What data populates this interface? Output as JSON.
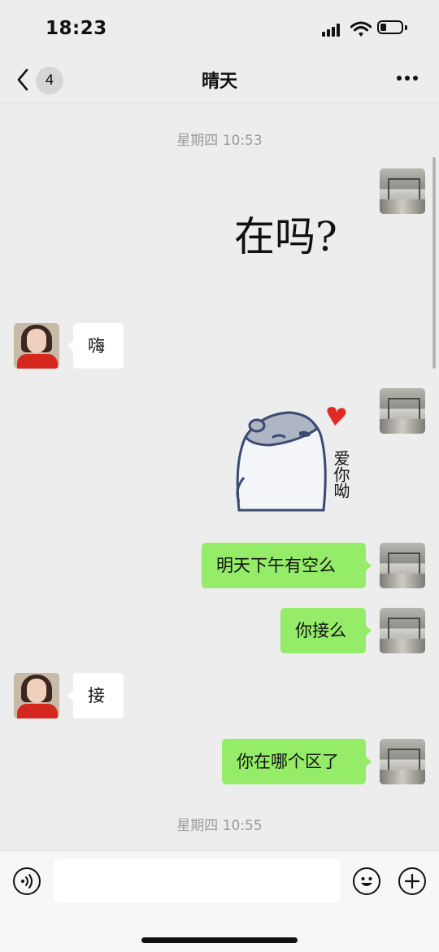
{
  "status_bar": {
    "time": "18:23",
    "battery_level": 0.3
  },
  "nav": {
    "back_badge": "4",
    "title": "晴天"
  },
  "chat": {
    "timestamps": [
      "星期四 10:53",
      "星期四 10:55"
    ],
    "messages": [
      {
        "from": "me",
        "type": "sticker",
        "text": "在吗?"
      },
      {
        "from": "her",
        "type": "text",
        "text": "嗨"
      },
      {
        "from": "me",
        "type": "sticker",
        "text": "爱你呦"
      },
      {
        "from": "me",
        "type": "text",
        "text": "明天下午有空么"
      },
      {
        "from": "me",
        "type": "text",
        "text": "你接么"
      },
      {
        "from": "her",
        "type": "text",
        "text": "接"
      },
      {
        "from": "me",
        "type": "text",
        "text": "你在哪个区了"
      }
    ]
  },
  "colors": {
    "outgoing_bubble": "#95ec69",
    "incoming_bubble": "#ffffff",
    "background": "#ededed"
  },
  "input_bar": {
    "icons": [
      "voice-icon",
      "emoji-icon",
      "plus-icon"
    ]
  }
}
